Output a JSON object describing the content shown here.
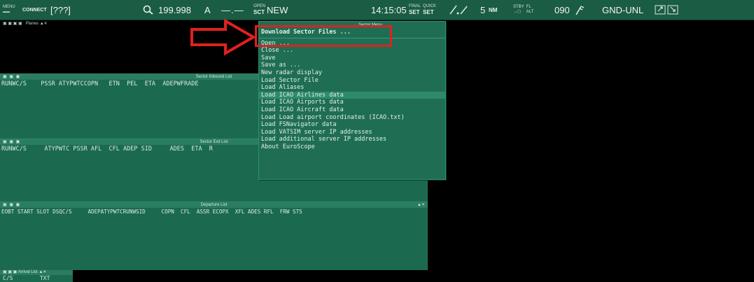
{
  "toolbar": {
    "menu_small": "MENU",
    "connect": "CONNECT",
    "callsign": "[???]",
    "frequency": "199.998",
    "atis_letter": "A",
    "dashes": "—.—",
    "open_small": "OPEN",
    "sct_label": "SCT",
    "sct_state": "NEW",
    "time": "14:15:05",
    "gnd_small": "FINAL",
    "quick_small": "QUICK",
    "set1": "SET",
    "set2": "SET",
    "range_value": "5",
    "range_unit": "NM",
    "stby_small": "STBY",
    "fl_small": "FL",
    "alt_small": "ALT",
    "heading": "090",
    "gnd_unl": "GND-UNL"
  },
  "planes_panel": {
    "title": "Planes"
  },
  "inbound_list": {
    "title": "Sector Inbound List",
    "columns": "RUNWC/S    PSSR ATYPWTCCOPN   ETN  PEL  ETA  ADEPWFRADE"
  },
  "exit_list": {
    "title": "Sector Exit List",
    "columns": "RUNWC/S     ATYPWTC PSSR AFL  CFL ADEP SID     ADES  ETA  R"
  },
  "departure_list": {
    "title": "Departure List",
    "columns": "EOBT START SLOT DSQC/S     ADEPATYPWTCRUNWSID     COPN  CFL  ASSR ECOPX  XFL ADES RFL  FRW STS"
  },
  "arrival_list": {
    "title": "Arrival List",
    "columns": "C/S        TXT"
  },
  "sector_menu": {
    "title": "Sector Menu",
    "items": [
      "Download Sector Files ...",
      "Open ...",
      "Close ...",
      "Save",
      "Save as ...",
      "New radar display",
      "Load Sector File",
      "Load Aliases",
      "Load ICAO Airlines data",
      "Load ICAO Airports data",
      "Load ICAO Aircraft data",
      "Load Load airport coordinates (ICAO.txt)",
      "Load FSNavigator data",
      "Load VATSIM server IP addresses",
      "Load additional server IP addresses",
      "About EuroScope"
    ]
  },
  "colors": {
    "toolbar": "#1a5c44",
    "panel": "#1b6a50",
    "menu": "#1f6e53",
    "highlight": "#e02020"
  }
}
